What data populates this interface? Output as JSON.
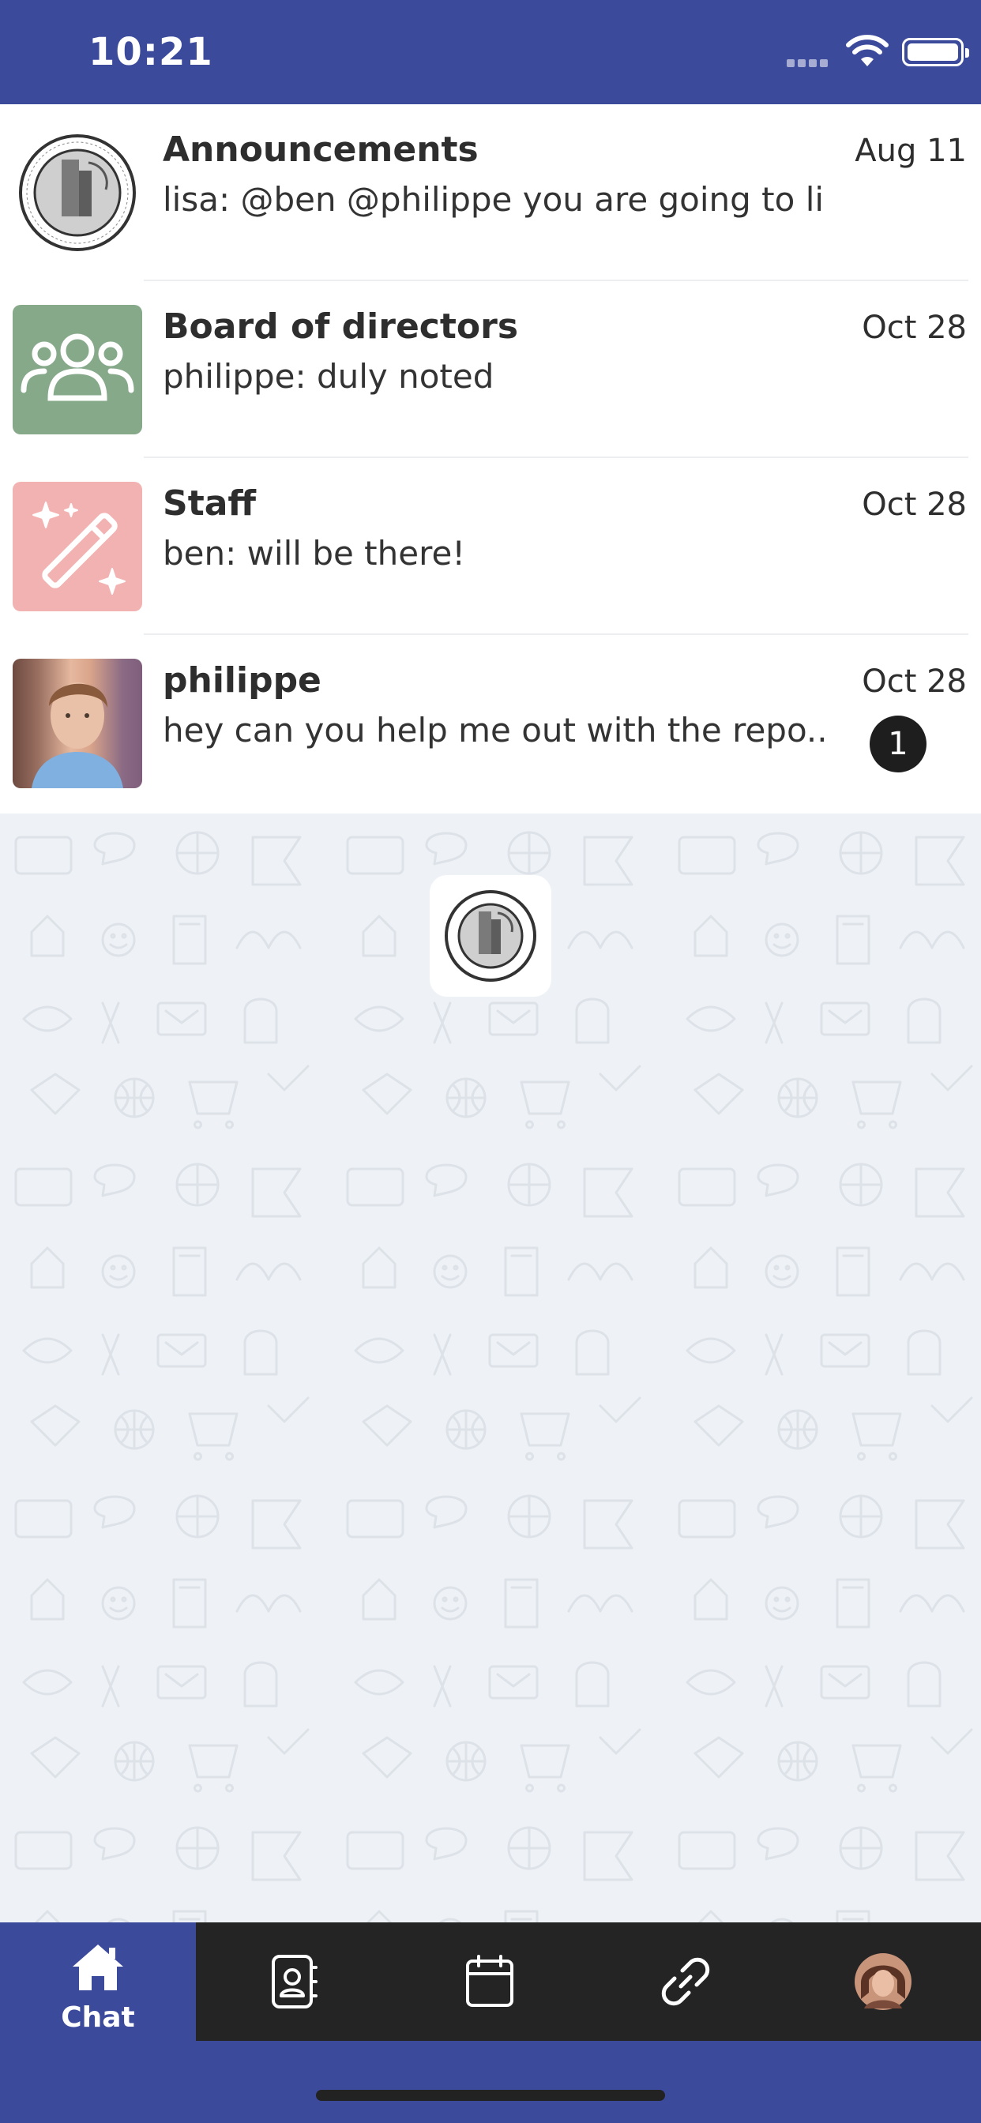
{
  "status_bar": {
    "time": "10:21",
    "icons": [
      "signal-icon",
      "wifi-icon",
      "battery-icon"
    ]
  },
  "chats": [
    {
      "title": "Announcements",
      "preview": "lisa: @ben @philippe you are going to li...",
      "date": "Aug 11",
      "avatar": "lodge-seal-icon"
    },
    {
      "title": "Board of directors",
      "preview": "philippe: duly noted",
      "date": "Oct 28",
      "avatar": "group-people-icon"
    },
    {
      "title": "Staff",
      "preview": "ben: will be there!",
      "date": "Oct 28",
      "avatar": "magic-wand-icon"
    },
    {
      "title": "philippe",
      "preview": "hey can you help me out with the repo...",
      "date": "Oct 28",
      "unread": "1",
      "avatar": "user-photo"
    }
  ],
  "tabs": [
    {
      "label": "Chat",
      "icon": "home-icon",
      "active": true
    },
    {
      "label": "",
      "icon": "contacts-icon",
      "active": false
    },
    {
      "label": "",
      "icon": "calendar-icon",
      "active": false
    },
    {
      "label": "",
      "icon": "link-icon",
      "active": false
    },
    {
      "label": "",
      "icon": "profile-avatar",
      "active": false
    }
  ],
  "colors": {
    "brand": "#3c4a9c",
    "tab_bar": "#242424",
    "background": "#eef1f5",
    "group_avatar": "#86a98a",
    "staff_avatar": "#f3b2b2",
    "badge": "#1e1e1e"
  }
}
